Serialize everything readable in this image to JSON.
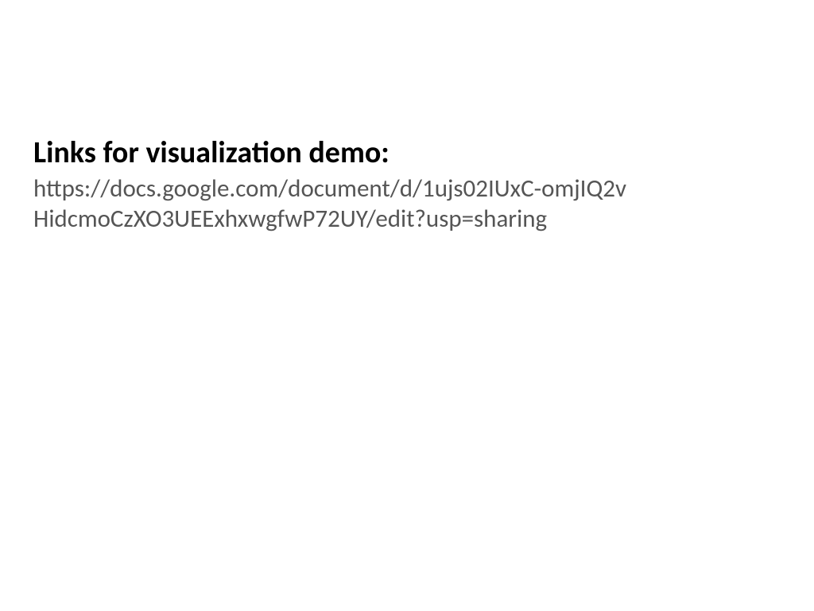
{
  "slide": {
    "title": "Links for visualization demo:",
    "body": "https://docs.google.com/document/d/1ujs02IUxC-omjIQ2vHidcmoCzXO3UEExhxwgfwP72UY/edit?usp=sharing"
  }
}
